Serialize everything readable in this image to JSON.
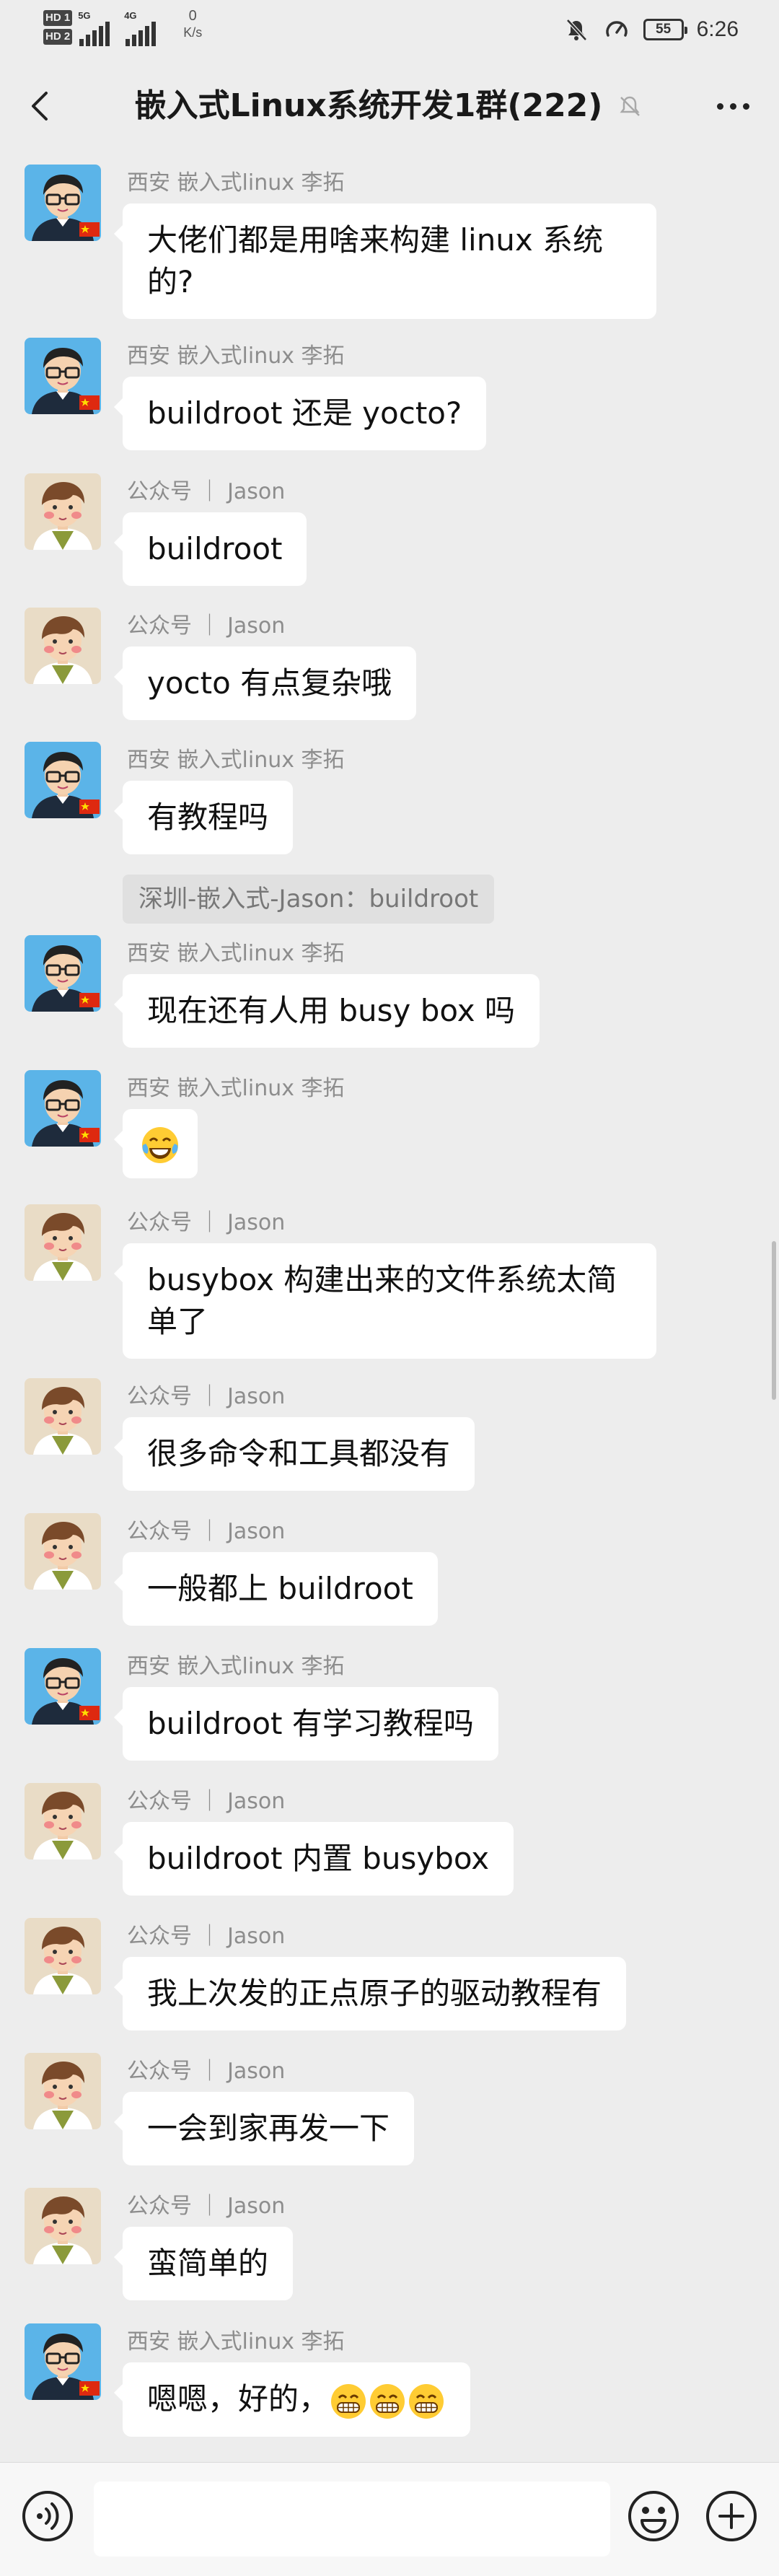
{
  "status_bar": {
    "hd1": "HD 1",
    "hd2": "HD 2",
    "net1": "5G",
    "net2": "4G",
    "speed_value": "0",
    "speed_unit": "K/s",
    "battery": "55",
    "time": "6:26"
  },
  "header": {
    "title": "嵌入式Linux系统开发1群(222)"
  },
  "messages": [
    {
      "sender": "西安 嵌入式linux 李拓",
      "text": "大佬们都是用啥来构建 linux 系统的?",
      "avatar": "glasses"
    },
    {
      "sender": "西安 嵌入式linux 李拓",
      "text": "buildroot 还是 yocto?",
      "avatar": "glasses"
    },
    {
      "sender": "公众号 ｜ Jason",
      "text": "buildroot",
      "avatar": "jason"
    },
    {
      "sender": "公众号 ｜ Jason",
      "text": "yocto 有点复杂哦",
      "avatar": "jason"
    },
    {
      "sender": "西安 嵌入式linux 李拓",
      "text": "有教程吗",
      "avatar": "glasses"
    },
    {
      "sender": "西安 嵌入式linux 李拓",
      "text": "现在还有人用 busy box 吗",
      "avatar": "glasses"
    },
    {
      "sender": "西安 嵌入式linux 李拓",
      "text": "",
      "avatar": "glasses",
      "emoji": "tears-of-joy"
    },
    {
      "sender": "公众号 ｜ Jason",
      "text": "busybox 构建出来的文件系统太简单了",
      "avatar": "jason"
    },
    {
      "sender": "公众号 ｜ Jason",
      "text": "很多命令和工具都没有",
      "avatar": "jason"
    },
    {
      "sender": "公众号 ｜ Jason",
      "text": "一般都上 buildroot",
      "avatar": "jason"
    },
    {
      "sender": "西安 嵌入式linux 李拓",
      "text": "buildroot 有学习教程吗",
      "avatar": "glasses"
    },
    {
      "sender": "公众号 ｜ Jason",
      "text": "buildroot 内置 busybox",
      "avatar": "jason"
    },
    {
      "sender": "公众号 ｜ Jason",
      "text": "我上次发的正点原子的驱动教程有",
      "avatar": "jason"
    },
    {
      "sender": "公众号 ｜ Jason",
      "text": "一会到家再发一下",
      "avatar": "jason"
    },
    {
      "sender": "公众号 ｜ Jason",
      "text": "蛮简单的",
      "avatar": "jason"
    },
    {
      "sender": "西安 嵌入式linux 李拓",
      "text": "嗯嗯，好的，",
      "avatar": "glasses",
      "trailing_emoji": "grinning x3"
    }
  ],
  "quote": {
    "text": "深圳-嵌入式-Jason：buildroot"
  },
  "input": {
    "value": "",
    "placeholder": ""
  },
  "colors": {
    "background": "#ededed",
    "bubble": "#ffffff",
    "sender_text": "#8d8d8d",
    "quote_bg": "#e0e0e0"
  }
}
